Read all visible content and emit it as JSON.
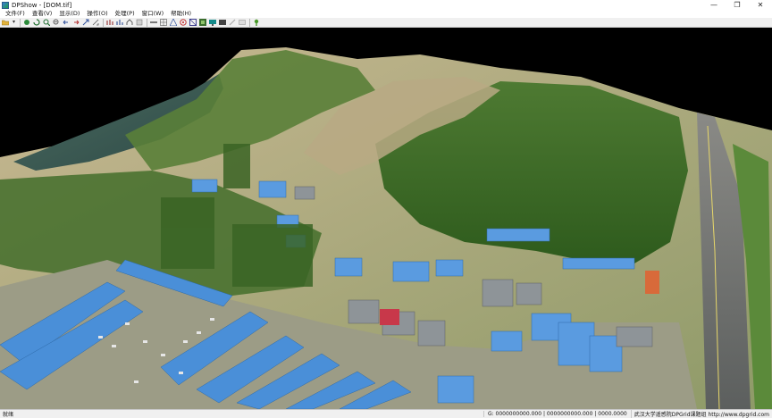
{
  "window": {
    "title": "DPShow - [DOM.tif]",
    "minimize": "—",
    "restore": "❐",
    "close": "✕"
  },
  "menu": {
    "items": [
      "文件(F)",
      "查看(V)",
      "显示(D)",
      "操作(O)",
      "处理(P)",
      "窗口(W)",
      "帮助(H)"
    ]
  },
  "toolbar": {
    "icons": [
      "open-icon",
      "dropdown-icon",
      "pan-icon",
      "rotate-icon",
      "zoom-in-icon",
      "zoom-out-icon",
      "undo-icon",
      "redo-icon",
      "fit-icon",
      "measure-icon",
      "height-icon",
      "profile-icon",
      "flag-icon",
      "layer-icon",
      "bar-icon",
      "grid-icon",
      "mesh-icon",
      "network-icon",
      "wireframe-icon",
      "texture-icon",
      "monitor-icon",
      "surface-icon",
      "point-icon",
      "frame-icon",
      "light-icon"
    ]
  },
  "status": {
    "ready": "就绪",
    "coords": "G: 0000000000.000 | 0000000000.000 | 0000.0000",
    "org": "武汉大学遥感院DPGrid课题组 http://www.dpgrid.com"
  },
  "colors": {
    "sky": "#000000",
    "water": "#3d5a52",
    "vegetation": "#3c6b26",
    "roof_blue": "#4a8fd8",
    "ground": "#b3a98a"
  }
}
